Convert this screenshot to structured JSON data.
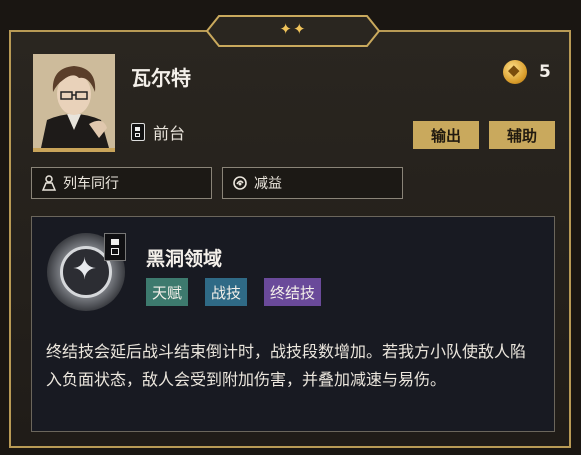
{
  "header": {
    "stars": "✦✦"
  },
  "character": {
    "name": "瓦尔特",
    "path": "前台",
    "rarity_value": "5",
    "roles": [
      "输出",
      "辅助"
    ]
  },
  "tags": [
    {
      "icon": "train-icon",
      "label": "列车同行"
    },
    {
      "icon": "debuff-icon",
      "label": "减益"
    }
  ],
  "skill": {
    "title": "黑洞领域",
    "chips": [
      {
        "label": "天赋",
        "color": "#3d7a6e"
      },
      {
        "label": "战技",
        "color": "#2f6a86"
      },
      {
        "label": "终结技",
        "color": "#6a4a9a"
      }
    ],
    "description": "终结技会延后战斗结束倒计时，战技段数增加。若我方小队使敌人陷入负面状态，敌人会受到附加伤害，并叠加减速与易伤。"
  },
  "colors": {
    "accent": "#c9a95d",
    "border": "#b89a55"
  }
}
